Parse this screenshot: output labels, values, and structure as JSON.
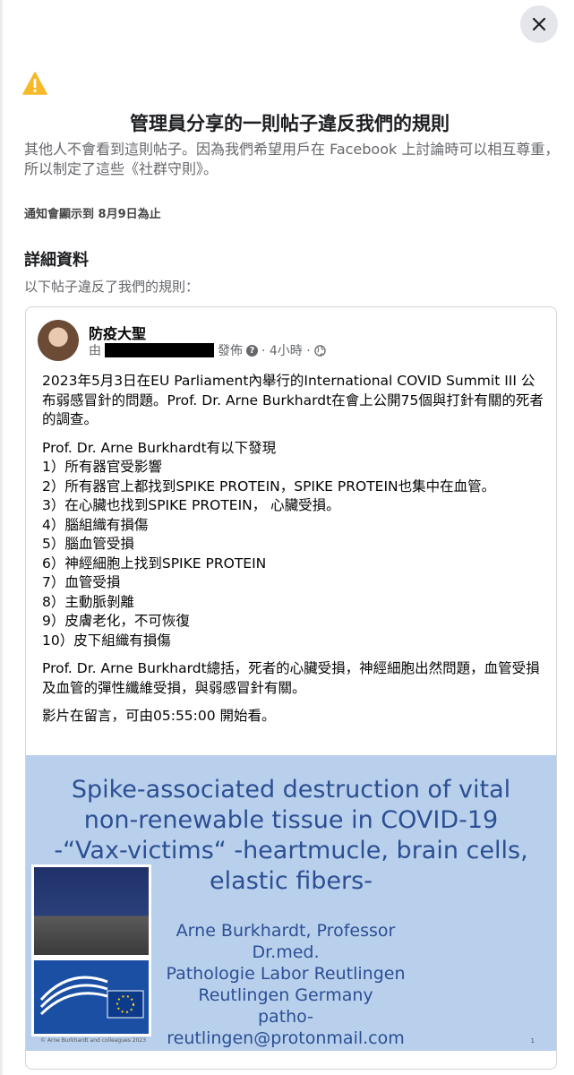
{
  "dialog": {
    "title": "管理員分享的一則帖子違反我們的規則",
    "description": "其他人不會看到這則帖子。因為我們希望用戶在 Facebook 上討論時可以相互尊重，所以制定了這些《社群守則》。",
    "expiry": "通知會顯示到 8月9日為止",
    "details_heading": "詳細資料",
    "details_sub": "以下帖子違反了我們的規則："
  },
  "post": {
    "author": "防疫大聖",
    "by_prefix": "由",
    "published": "發佈",
    "time": "· 4小時 ·",
    "para1": "2023年5月3日在EU Parliament內舉行的International COVID Summit III 公布弱感冒針的問題。Prof. Dr. Arne Burkhardt在會上公開75個與打針有關的死者的調查。",
    "findings_intro": "Prof. Dr. Arne Burkhardt有以下發現",
    "findings": [
      "1）所有器官受影響",
      "2）所有器官上都找到SPIKE PROTEIN，SPIKE PROTEIN也集中在血管。",
      "3）在心臟也找到SPIKE PROTEIN， 心臟受損。",
      "4）腦組織有損傷",
      "5）腦血管受損",
      "6）神經細胞上找到SPIKE PROTEIN",
      "7）血管受損",
      "8）主動脈剝離",
      "9）皮膚老化，不可恢復",
      "10）皮下組織有損傷"
    ],
    "summary": "Prof. Dr. Arne Burkhardt總括，死者的心臟受損，神經細胞出然問題，血管受損及血管的彈性纖維受損，與弱感冒針有關。",
    "video_note": "影片在留言，可由05:55:00 開始看。"
  },
  "slide": {
    "title": "Spike-associated destruction of vital non-renewable tissue in COVID-19 -“Vax-victims“ -heartmucle, brain cells, elastic fibers-",
    "author_lines": [
      "Arne Burkhardt, Professor Dr.med.",
      "Pathologie Labor Reutlingen",
      "Reutlingen Germany",
      "patho-reutlingen@protonmail.com"
    ],
    "footer": "© Arne Burkhardt and colleagues 2023",
    "page": "1"
  },
  "icons": {
    "close": "close-icon",
    "warning": "warning-triangle-icon",
    "privacy": "globe-icon",
    "help": "question-icon"
  },
  "colors": {
    "warning": "#f7b928",
    "slide_bg": "#b9d0ec",
    "slide_text": "#2c4f93"
  }
}
